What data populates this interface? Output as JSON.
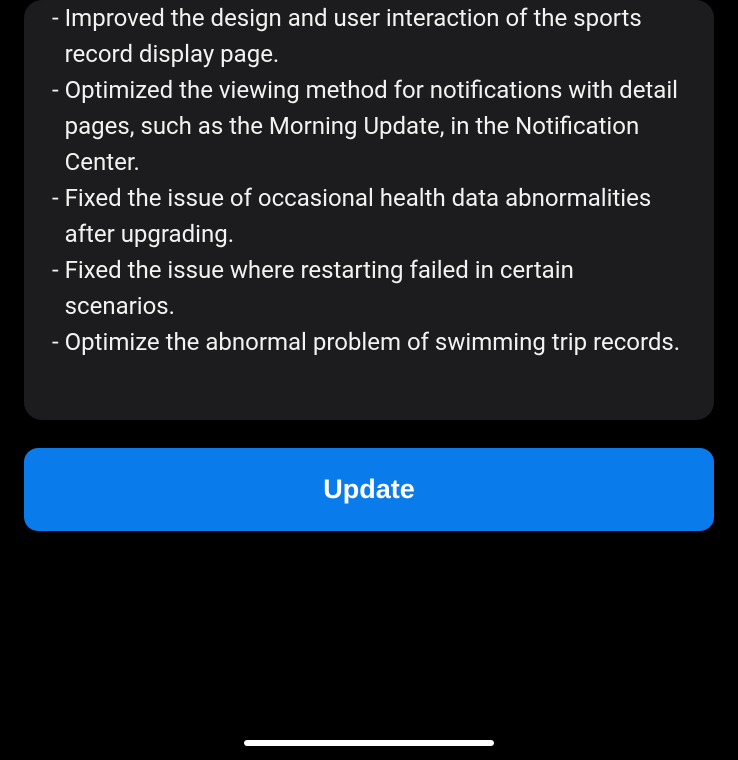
{
  "changelog": {
    "items": [
      "Improved the design and user interaction of the sports record display page.",
      "Optimized the viewing method for notifications with detail pages, such as the Morning Update, in the Notification Center.",
      "Fixed the issue of occasional health data abnormalities after upgrading.",
      "Fixed the issue where restarting failed in certain scenarios.",
      "Optimize the abnormal problem of swimming trip records."
    ]
  },
  "actions": {
    "update_label": "Update"
  }
}
